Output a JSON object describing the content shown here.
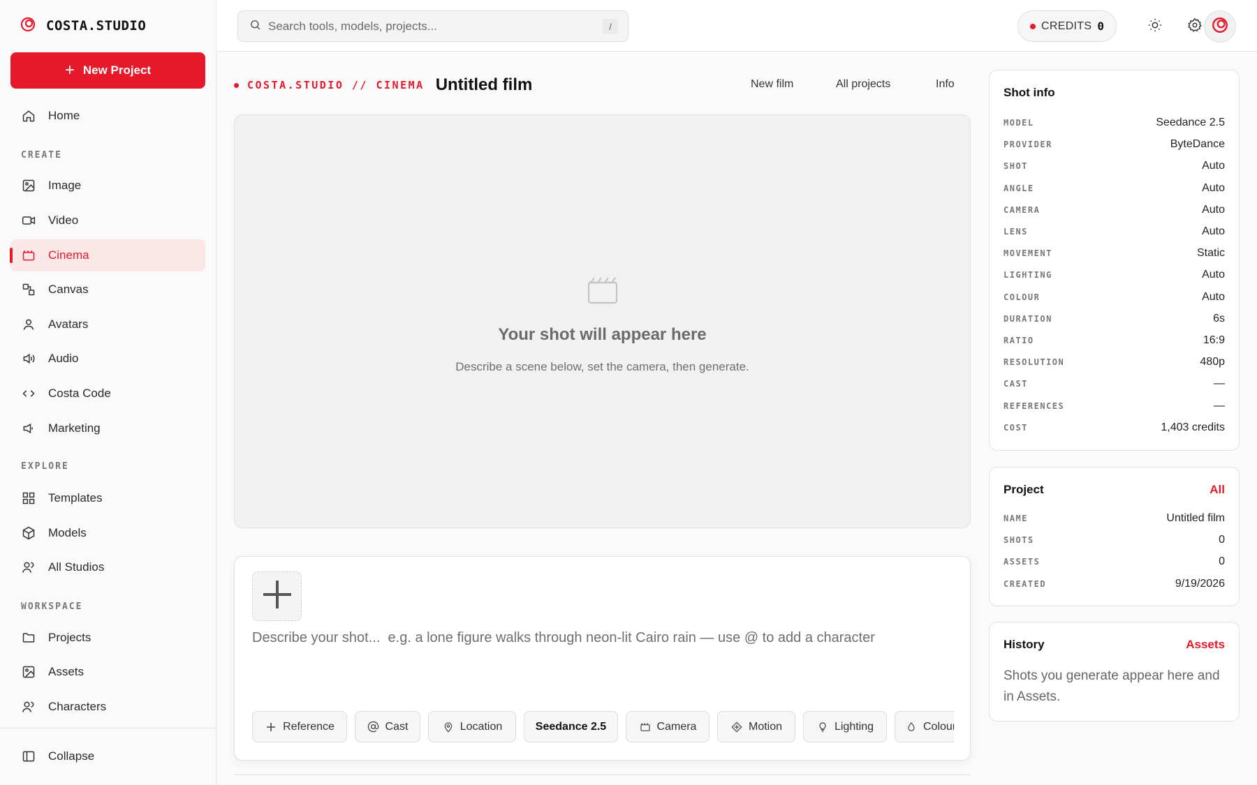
{
  "brand": {
    "name": "COSTA.STUDIO"
  },
  "sidebar": {
    "new_project_label": "New Project",
    "home": "Home",
    "sections": {
      "create": "CREATE",
      "explore": "EXPLORE",
      "workspace": "WORKSPACE"
    },
    "create_items": [
      {
        "label": "Image",
        "icon": "image-icon"
      },
      {
        "label": "Video",
        "icon": "video-icon"
      },
      {
        "label": "Cinema",
        "icon": "clapper-icon",
        "active": true
      },
      {
        "label": "Canvas",
        "icon": "canvas-icon"
      },
      {
        "label": "Avatars",
        "icon": "user-icon"
      },
      {
        "label": "Audio",
        "icon": "speaker-icon"
      },
      {
        "label": "Costa Code",
        "icon": "code-icon"
      },
      {
        "label": "Marketing",
        "icon": "megaphone-icon"
      }
    ],
    "explore_items": [
      {
        "label": "Templates",
        "icon": "grid-icon"
      },
      {
        "label": "Models",
        "icon": "cube-icon"
      },
      {
        "label": "All Studios",
        "icon": "users-icon"
      }
    ],
    "workspace_items": [
      {
        "label": "Projects",
        "icon": "folder-icon"
      },
      {
        "label": "Assets",
        "icon": "image-icon"
      },
      {
        "label": "Characters",
        "icon": "users-icon"
      }
    ],
    "collapse_label": "Collapse"
  },
  "topbar": {
    "search_placeholder": "Search tools, models, projects...",
    "search_shortcut": "/",
    "credits_label": "CREDITS",
    "credits_value": "0"
  },
  "header": {
    "breadcrumb": "COSTA.STUDIO // CINEMA",
    "title": "Untitled film",
    "links": [
      "New film",
      "All projects",
      "Info"
    ]
  },
  "preview": {
    "title": "Your shot will appear here",
    "subtitle": "Describe a scene below, set the camera, then generate."
  },
  "composer": {
    "placeholder": "Describe your shot...  e.g. a lone figure walks through neon-lit Cairo rain — use @ to add a character",
    "chips": [
      "Reference",
      "Cast",
      "Location",
      "Seedance 2.5",
      "Camera",
      "Motion",
      "Lighting",
      "Colour"
    ]
  },
  "shot_info": {
    "title": "Shot info",
    "rows": [
      {
        "key": "MODEL",
        "value": "Seedance 2.5"
      },
      {
        "key": "PROVIDER",
        "value": "ByteDance"
      },
      {
        "key": "SHOT",
        "value": "Auto"
      },
      {
        "key": "ANGLE",
        "value": "Auto"
      },
      {
        "key": "CAMERA",
        "value": "Auto"
      },
      {
        "key": "LENS",
        "value": "Auto"
      },
      {
        "key": "MOVEMENT",
        "value": "Static"
      },
      {
        "key": "LIGHTING",
        "value": "Auto"
      },
      {
        "key": "COLOUR",
        "value": "Auto"
      },
      {
        "key": "DURATION",
        "value": "6s"
      },
      {
        "key": "RATIO",
        "value": "16:9"
      },
      {
        "key": "RESOLUTION",
        "value": "480p"
      },
      {
        "key": "CAST",
        "value": "—"
      },
      {
        "key": "REFERENCES",
        "value": "—"
      },
      {
        "key": "COST",
        "value": "1,403 credits"
      }
    ]
  },
  "project": {
    "title": "Project",
    "link": "All",
    "rows": [
      {
        "key": "NAME",
        "value": "Untitled film"
      },
      {
        "key": "SHOTS",
        "value": "0"
      },
      {
        "key": "ASSETS",
        "value": "0"
      },
      {
        "key": "CREATED",
        "value": "9/19/2026"
      }
    ]
  },
  "history": {
    "title": "History",
    "link": "Assets",
    "text": "Shots you generate appear here and in Assets."
  },
  "colors": {
    "accent": "#e6192b",
    "accent_bg": "#fbe7e8"
  }
}
